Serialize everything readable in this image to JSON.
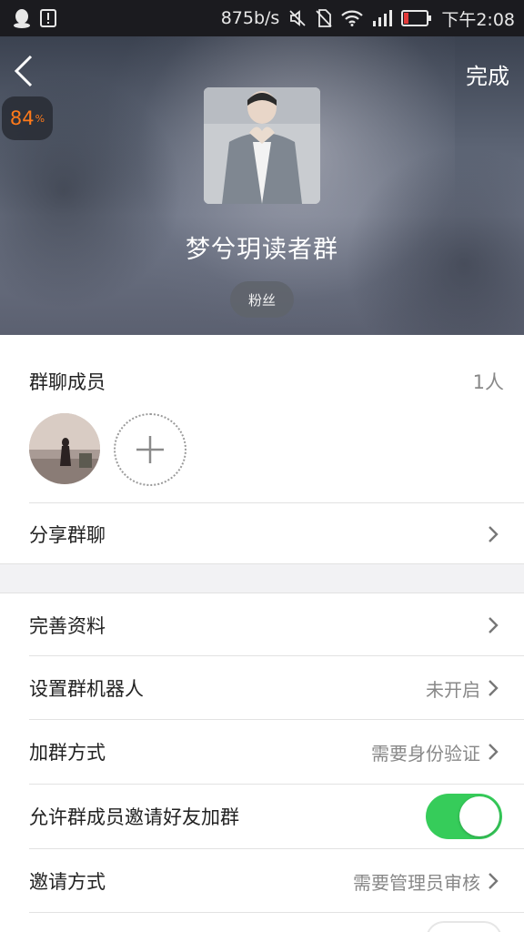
{
  "status_bar": {
    "net_speed": "875b/s",
    "time": "下午2:08"
  },
  "header": {
    "done_label": "完成",
    "battery_badge": "84",
    "battery_unit": "%",
    "group_name": "梦兮玥读者群",
    "tag": "粉丝"
  },
  "members": {
    "title": "群聊成员",
    "count": "1人"
  },
  "rows": {
    "share": {
      "label": "分享群聊"
    },
    "profile": {
      "label": "完善资料"
    },
    "robot": {
      "label": "设置群机器人",
      "value": "未开启"
    },
    "join_method": {
      "label": "加群方式",
      "value": "需要身份验证"
    },
    "allow_invite": {
      "label": "允许群成员邀请好友加群",
      "toggle": true
    },
    "invite_method": {
      "label": "邀请方式",
      "value": "需要管理员审核"
    }
  },
  "colors": {
    "toggle_on": "#36cc5a",
    "battery_badge_text": "#ff7a1a",
    "status_bar_bg": "#1b1b1f"
  }
}
